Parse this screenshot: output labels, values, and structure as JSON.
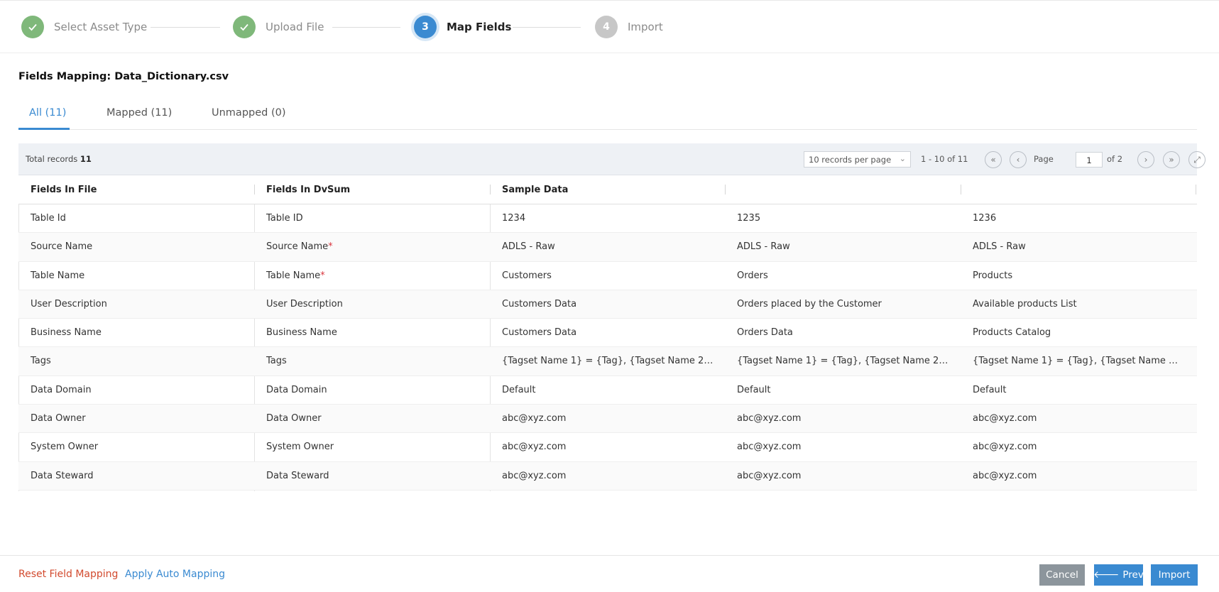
{
  "stepper": {
    "steps": [
      {
        "number": "1",
        "label": "Select Asset Type",
        "status": "done",
        "icon": "check-icon"
      },
      {
        "number": "2",
        "label": "Upload File",
        "status": "done",
        "icon": "check-icon"
      },
      {
        "number": "3",
        "label": "Map Fields",
        "status": "active"
      },
      {
        "number": "4",
        "label": "Import",
        "status": "pending"
      }
    ]
  },
  "page": {
    "title": "Fields Mapping: Data_Dictionary.csv"
  },
  "tabs": [
    {
      "label": "All (11)",
      "active": true
    },
    {
      "label": "Mapped (11)",
      "active": false
    },
    {
      "label": "Unmapped (0)",
      "active": false
    }
  ],
  "toolbar": {
    "total_label": "Total records",
    "total_count": "11",
    "records_per_page": "10 records per page",
    "range": "1 - 10 of 11",
    "page_label": "Page",
    "page_value": "1",
    "of_label": "of 2",
    "icons": {
      "first": "double-chevron-left-icon",
      "prev": "chevron-left-icon",
      "next": "chevron-right-icon",
      "last": "double-chevron-right-icon",
      "expand": "expand-icon"
    }
  },
  "table": {
    "headers": [
      "Fields In File",
      "Fields In DvSum",
      "Sample Data",
      "",
      ""
    ],
    "rows": [
      {
        "file": "Table Id",
        "dvsum": "Table ID",
        "required": false,
        "s1": "1234",
        "s2": "1235",
        "s3": "1236"
      },
      {
        "file": "Source Name",
        "dvsum": "Source Name",
        "required": true,
        "s1": "ADLS - Raw",
        "s2": "ADLS - Raw",
        "s3": "ADLS - Raw"
      },
      {
        "file": "Table Name",
        "dvsum": "Table Name",
        "required": true,
        "s1": "Customers",
        "s2": "Orders",
        "s3": "Products"
      },
      {
        "file": "User Description",
        "dvsum": "User Description",
        "required": false,
        "s1": "Customers Data",
        "s2": "Orders placed by the Customer",
        "s3": "Available products List"
      },
      {
        "file": "Business Name",
        "dvsum": "Business Name",
        "required": false,
        "s1": "Customers Data",
        "s2": "Orders Data",
        "s3": "Products Catalog"
      },
      {
        "file": "Tags",
        "dvsum": "Tags",
        "required": false,
        "s1": "{Tagset Name 1} = {Tag}, {Tagset Name 2} = {T...",
        "s2": "{Tagset Name 1} = {Tag}, {Tagset Name 2} = {T...",
        "s3": "{Tagset Name 1} = {Tag}, {Tagset Name 2} = {T..."
      },
      {
        "file": "Data Domain",
        "dvsum": "Data Domain",
        "required": false,
        "s1": "Default",
        "s2": "Default",
        "s3": "Default"
      },
      {
        "file": "Data Owner",
        "dvsum": "Data Owner",
        "required": false,
        "s1": "abc@xyz.com",
        "s2": "abc@xyz.com",
        "s3": "abc@xyz.com"
      },
      {
        "file": "System Owner",
        "dvsum": "System Owner",
        "required": false,
        "s1": "abc@xyz.com",
        "s2": "abc@xyz.com",
        "s3": "abc@xyz.com"
      },
      {
        "file": "Data Steward",
        "dvsum": "Data Steward",
        "required": false,
        "s1": "abc@xyz.com",
        "s2": "abc@xyz.com",
        "s3": "abc@xyz.com"
      }
    ]
  },
  "footer": {
    "reset_label": "Reset Field Mapping",
    "auto_label": "Apply Auto Mapping",
    "cancel_label": "Cancel",
    "prev_label": "Prev",
    "prev_icon": "arrow-left-icon",
    "import_label": "Import"
  },
  "colors": {
    "accent": "#3a8ad1",
    "done": "#7fb87a",
    "pending": "#c7c7c7",
    "danger": "#d24a2e",
    "required": "#d9363e"
  }
}
